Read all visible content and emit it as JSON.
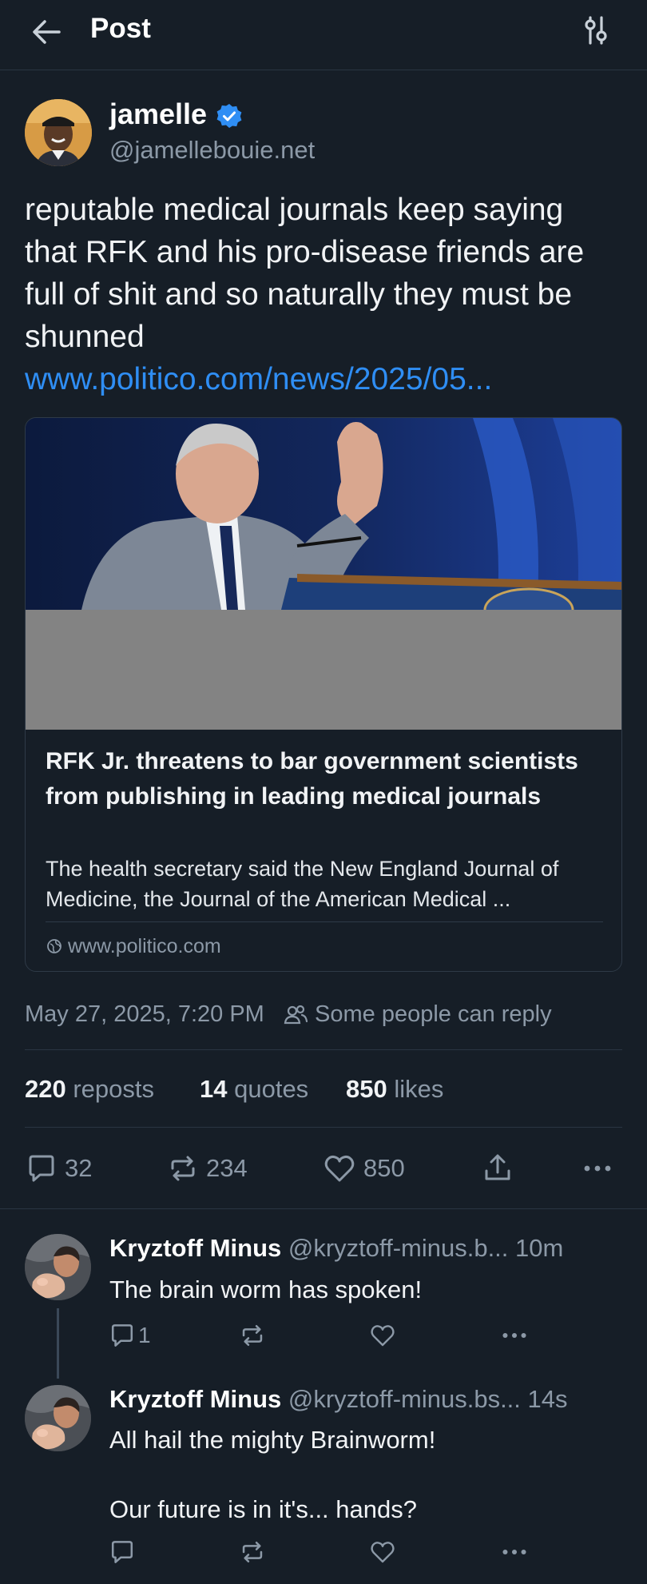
{
  "header": {
    "title": "Post"
  },
  "post": {
    "author_name": "jamelle",
    "author_handle": "@jamellebouie.net",
    "text": "reputable medical journals keep saying that RFK and his pro-disease friends are full of shit and so naturally they must be shunned",
    "link_text": "www.politico.com/news/2025/05...",
    "card": {
      "title": "RFK Jr. threatens to bar government scientists from publishing in leading medical journals",
      "description": "The health secretary said the New England Journal of Medicine, the Journal of the American Medical ...",
      "domain": "www.politico.com"
    },
    "timestamp": "May 27, 2025, 7:20 PM",
    "reply_setting": "Some people can reply",
    "stats": {
      "reposts_count": "220",
      "reposts_label": "reposts",
      "quotes_count": "14",
      "quotes_label": "quotes",
      "likes_count": "850",
      "likes_label": "likes"
    },
    "actions": {
      "replies": "32",
      "reposts": "234",
      "likes": "850"
    }
  },
  "replies": [
    {
      "name": "Kryztoff Minus",
      "handle": "@kryztoff-minus.b...",
      "time": "10m",
      "text": "The brain worm has spoken!",
      "reply_count": "1"
    },
    {
      "name": "Kryztoff Minus",
      "handle": "@kryztoff-minus.bs...",
      "time": "14s",
      "text_line1": "All hail the mighty Brainworm!",
      "text_line2": "Our future is in it's... hands?"
    }
  ],
  "colors": {
    "accent": "#2f8ef4",
    "background": "#161e27",
    "muted": "#8c99a7",
    "verified": "#2f8ef4"
  },
  "icons": [
    "back-arrow-icon",
    "settings-sliders-icon",
    "verified-badge-icon",
    "globe-icon",
    "people-icon",
    "reply-icon",
    "repost-icon",
    "like-icon",
    "share-icon",
    "more-icon"
  ]
}
